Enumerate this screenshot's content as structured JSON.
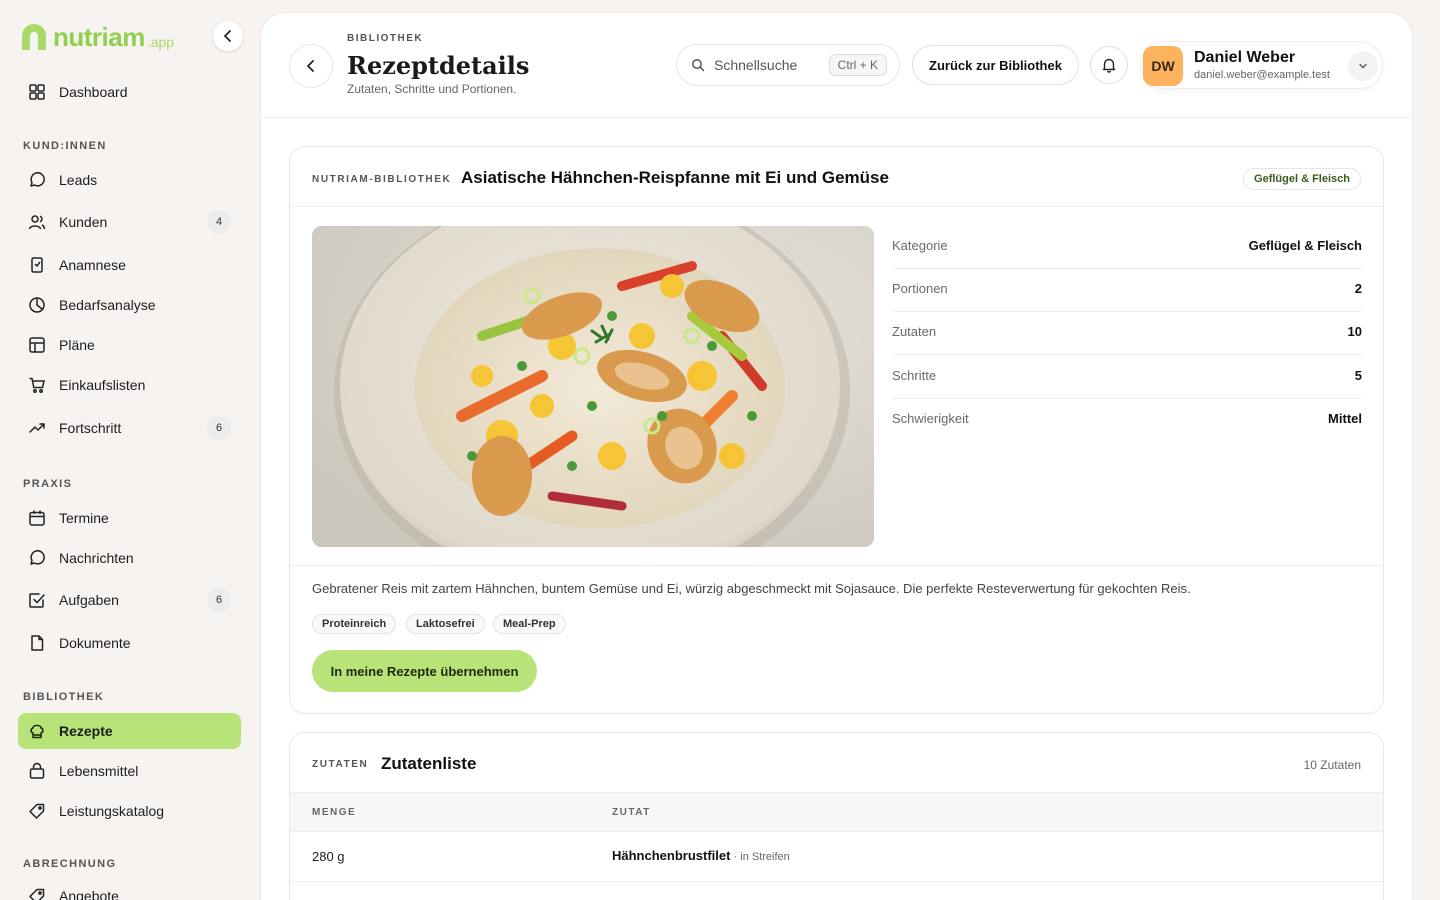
{
  "brand": {
    "name": "nutriam",
    "suffix": ".app"
  },
  "sidebar": {
    "items": [
      {
        "label": "Dashboard"
      },
      {
        "label": "Leads"
      },
      {
        "label": "Kunden",
        "badge": "4"
      },
      {
        "label": "Anamnese"
      },
      {
        "label": "Bedarfsanalyse"
      },
      {
        "label": "Pläne"
      },
      {
        "label": "Einkaufslisten"
      },
      {
        "label": "Fortschritt",
        "badge": "6"
      },
      {
        "label": "Termine"
      },
      {
        "label": "Nachrichten"
      },
      {
        "label": "Aufgaben",
        "badge": "6"
      },
      {
        "label": "Dokumente"
      },
      {
        "label": "Rezepte",
        "active": true
      },
      {
        "label": "Lebensmittel"
      },
      {
        "label": "Leistungskatalog"
      },
      {
        "label": "Angebote"
      }
    ],
    "sections": {
      "clients": "KUND:INNEN",
      "practice": "PRAXIS",
      "library": "BIBLIOTHEK",
      "billing": "ABRECHNUNG"
    }
  },
  "header": {
    "eyebrow": "BIBLIOTHEK",
    "title": "Rezeptdetails",
    "subtitle": "Zutaten, Schritte und Portionen.",
    "search_placeholder": "Schnellsuche",
    "search_shortcut": "Ctrl + K",
    "back_to_library": "Zurück zur Bibliothek"
  },
  "user": {
    "initials": "DW",
    "name": "Daniel Weber",
    "email": "daniel.weber@example.test"
  },
  "recipe": {
    "source": "NUTRIAM-BIBLIOTHEK",
    "title": "Asiatische Hähnchen-Reispfanne mit Ei und Gemüse",
    "category_tag": "Geflügel & Fleisch",
    "meta": [
      {
        "label": "Kategorie",
        "value": "Geflügel & Fleisch"
      },
      {
        "label": "Portionen",
        "value": "2"
      },
      {
        "label": "Zutaten",
        "value": "10"
      },
      {
        "label": "Schritte",
        "value": "5"
      },
      {
        "label": "Schwierigkeit",
        "value": "Mittel"
      }
    ],
    "description": "Gebratener Reis mit zartem Hähnchen, buntem Gemüse und Ei, würzig abgeschmeckt mit Sojasauce. Die perfekte Resteverwertung für gekochten Reis.",
    "tags": [
      "Proteinreich",
      "Laktosefrei",
      "Meal-Prep"
    ],
    "cta": "In meine Rezepte übernehmen"
  },
  "ingredients": {
    "eyebrow": "ZUTATEN",
    "title": "Zutatenliste",
    "count": "10 Zutaten",
    "columns": [
      "MENGE",
      "ZUTAT"
    ],
    "rows": [
      {
        "qty": "280 g",
        "name": "Hähnchenbrustfilet",
        "note": " · in Streifen"
      }
    ]
  },
  "colors": {
    "accent": "#b8e378",
    "brand": "#8fd14f",
    "avatar": "#fdb35e"
  }
}
